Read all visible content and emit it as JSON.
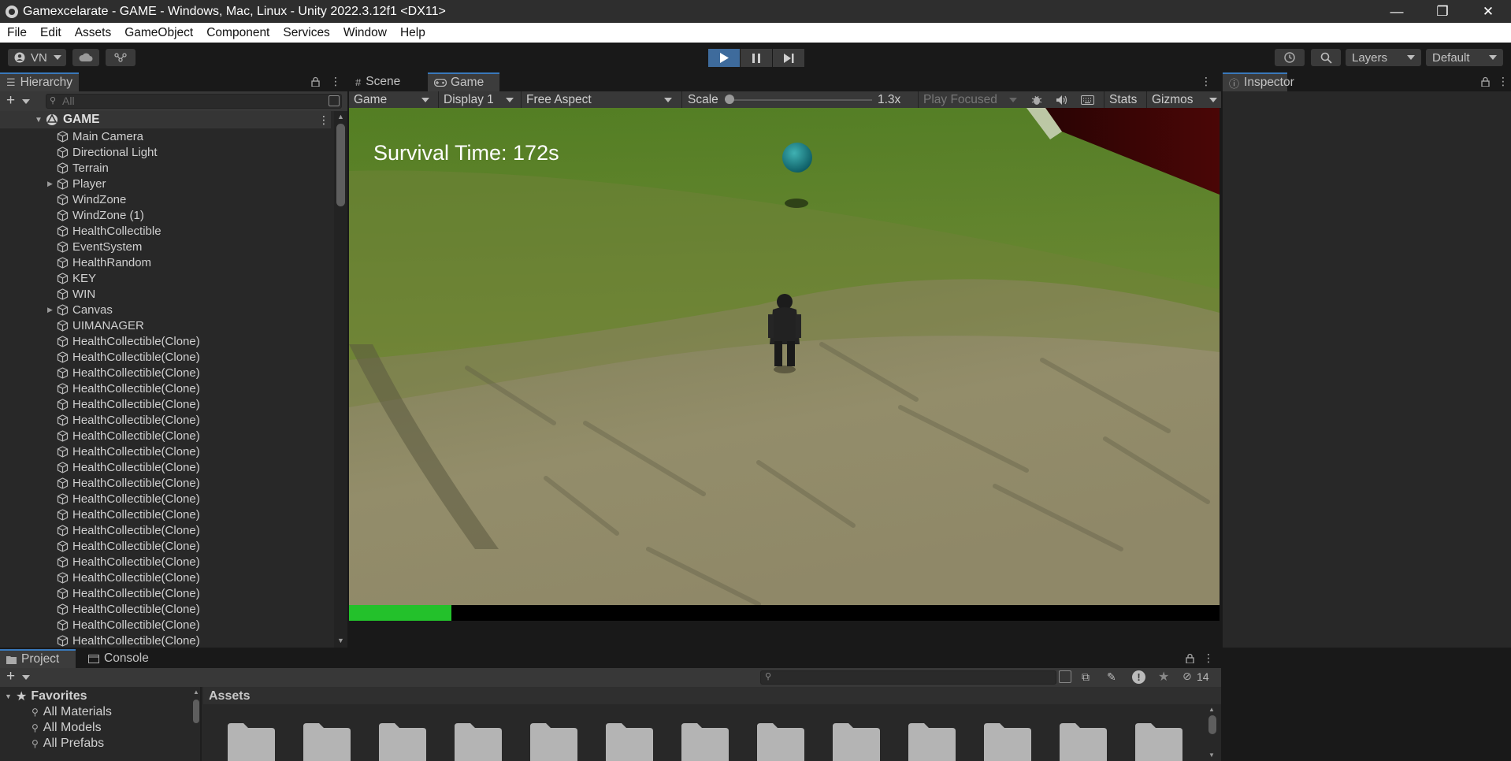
{
  "window": {
    "title": "Gamexcelarate - GAME - Windows, Mac, Linux - Unity 2022.3.12f1 <DX11>",
    "controls": [
      "—",
      "❐",
      "✕"
    ]
  },
  "menu": [
    "File",
    "Edit",
    "Assets",
    "GameObject",
    "Component",
    "Services",
    "Window",
    "Help"
  ],
  "toolbar": {
    "account_label": "VN",
    "layers_label": "Layers",
    "layout_label": "Default"
  },
  "hierarchy": {
    "tab_label": "Hierarchy",
    "search_placeholder": "All",
    "scene_name": "GAME",
    "items": [
      {
        "name": "Main Camera",
        "expandable": false
      },
      {
        "name": "Directional Light",
        "expandable": false
      },
      {
        "name": "Terrain",
        "expandable": false
      },
      {
        "name": "Player",
        "expandable": true
      },
      {
        "name": "WindZone",
        "expandable": false
      },
      {
        "name": "WindZone (1)",
        "expandable": false
      },
      {
        "name": "HealthCollectible",
        "expandable": false
      },
      {
        "name": "EventSystem",
        "expandable": false
      },
      {
        "name": "HealthRandom",
        "expandable": false
      },
      {
        "name": "KEY",
        "expandable": false
      },
      {
        "name": "WIN",
        "expandable": false
      },
      {
        "name": "Canvas",
        "expandable": true
      },
      {
        "name": "UIMANAGER",
        "expandable": false
      },
      {
        "name": "HealthCollectible(Clone)",
        "expandable": false
      },
      {
        "name": "HealthCollectible(Clone)",
        "expandable": false
      },
      {
        "name": "HealthCollectible(Clone)",
        "expandable": false
      },
      {
        "name": "HealthCollectible(Clone)",
        "expandable": false
      },
      {
        "name": "HealthCollectible(Clone)",
        "expandable": false
      },
      {
        "name": "HealthCollectible(Clone)",
        "expandable": false
      },
      {
        "name": "HealthCollectible(Clone)",
        "expandable": false
      },
      {
        "name": "HealthCollectible(Clone)",
        "expandable": false
      },
      {
        "name": "HealthCollectible(Clone)",
        "expandable": false
      },
      {
        "name": "HealthCollectible(Clone)",
        "expandable": false
      },
      {
        "name": "HealthCollectible(Clone)",
        "expandable": false
      },
      {
        "name": "HealthCollectible(Clone)",
        "expandable": false
      },
      {
        "name": "HealthCollectible(Clone)",
        "expandable": false
      },
      {
        "name": "HealthCollectible(Clone)",
        "expandable": false
      },
      {
        "name": "HealthCollectible(Clone)",
        "expandable": false
      },
      {
        "name": "HealthCollectible(Clone)",
        "expandable": false
      },
      {
        "name": "HealthCollectible(Clone)",
        "expandable": false
      },
      {
        "name": "HealthCollectible(Clone)",
        "expandable": false
      },
      {
        "name": "HealthCollectible(Clone)",
        "expandable": false
      },
      {
        "name": "HealthCollectible(Clone)",
        "expandable": false
      }
    ]
  },
  "views": {
    "scene_tab": "Scene",
    "game_tab": "Game",
    "game_toolbar": {
      "mode": "Game",
      "display": "Display 1",
      "aspect": "Free Aspect",
      "scale_label": "Scale",
      "scale_value": "1.3x",
      "play_focus": "Play Focused",
      "stats": "Stats",
      "gizmos": "Gizmos"
    },
    "hud": {
      "survival_text": "Survival Time: 172s",
      "health_fraction": 0.118
    }
  },
  "inspector": {
    "tab_label": "Inspector"
  },
  "project": {
    "project_tab": "Project",
    "console_tab": "Console",
    "favorites_label": "Favorites",
    "favorites": [
      "All Materials",
      "All Models",
      "All Prefabs"
    ],
    "assets_header": "Assets",
    "hidden_count": "14"
  },
  "colors": {
    "accent_blue": "#3a79bb",
    "play_active": "#3e6b9c",
    "health_green": "#23c12b"
  }
}
